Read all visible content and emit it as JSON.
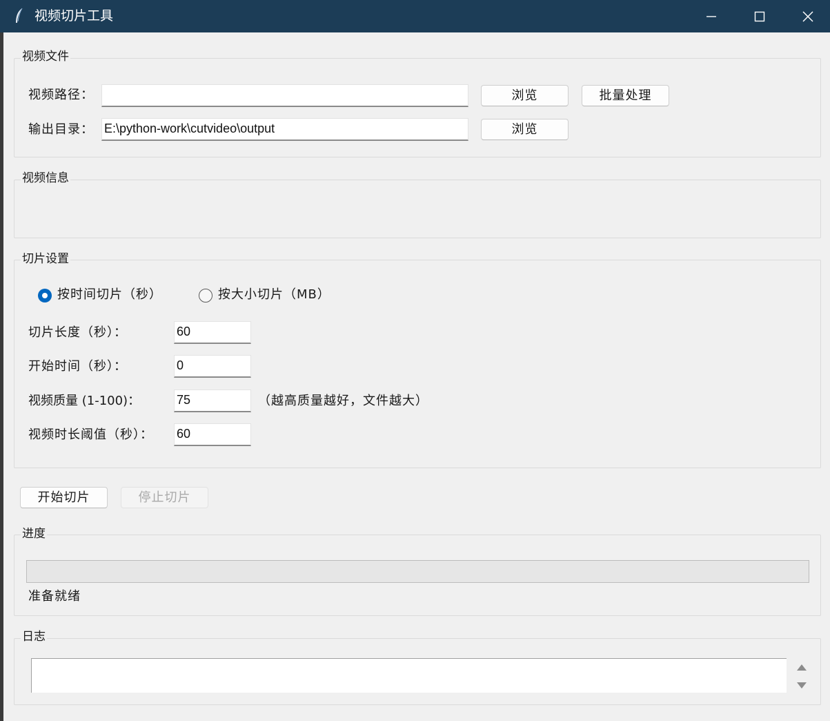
{
  "window": {
    "title": "视频切片工具",
    "colors": {
      "titlebar": "#1c3d57",
      "accent": "#0067c0"
    },
    "icons": {
      "app": "feather-icon",
      "minimize": "minimize-icon",
      "maximize": "maximize-icon",
      "close": "close-icon"
    }
  },
  "video_file": {
    "group_title": "视频文件",
    "path_label": "视频路径：",
    "path_value": "",
    "browse1": "浏览",
    "batch": "批量处理",
    "output_label": "输出目录：",
    "output_value": "E:\\python-work\\cutvideo\\output",
    "browse2": "浏览"
  },
  "video_info": {
    "group_title": "视频信息"
  },
  "slice_settings": {
    "group_title": "切片设置",
    "mode_time": "按时间切片（秒）",
    "mode_size": "按大小切片（MB）",
    "selected_mode": "按时间切片（秒）",
    "length_label": "切片长度（秒）：",
    "length_value": "60",
    "start_label": "开始时间（秒）：",
    "start_value": "0",
    "quality_label": "视频质量 (1-100)：",
    "quality_value": "75",
    "quality_hint": "（越高质量越好，文件越大）",
    "threshold_label": "视频时长阈值（秒）：",
    "threshold_value": "60"
  },
  "actions": {
    "start": "开始切片",
    "stop": "停止切片"
  },
  "progress": {
    "group_title": "进度",
    "value": 0,
    "status": "准备就绪"
  },
  "log": {
    "group_title": "日志",
    "content": ""
  }
}
